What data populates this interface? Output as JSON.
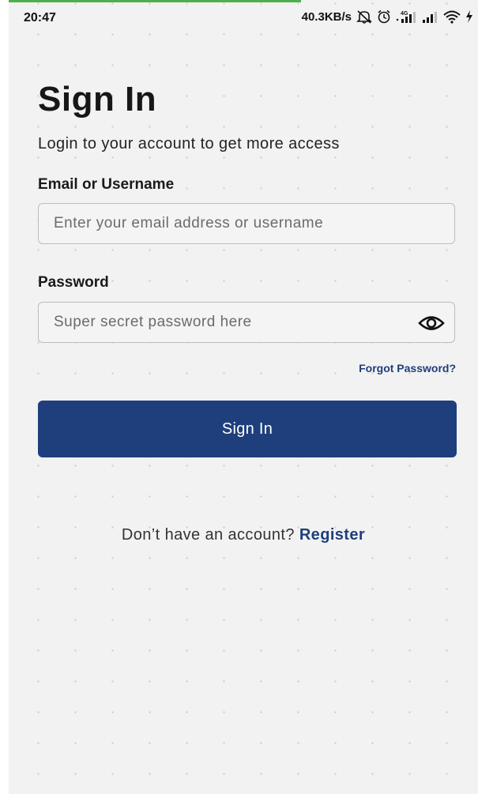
{
  "status_bar": {
    "time": "20:47",
    "net_speed": "40.3KB/s",
    "net_type": "4G"
  },
  "header": {
    "title": "Sign In",
    "subtitle": "Login to your account to get more access"
  },
  "form": {
    "email": {
      "label": "Email or Username",
      "placeholder": "Enter your email address or username",
      "value": ""
    },
    "password": {
      "label": "Password",
      "placeholder": "Super secret password here",
      "value": "",
      "toggle_icon": "eye-icon"
    },
    "forgot_password": "Forgot Password?",
    "submit_label": "Sign In"
  },
  "footer": {
    "prompt": "Don’t have an account?",
    "register_label": "Register"
  },
  "colors": {
    "primary": "#1e3f7c",
    "background": "#f2f2f2",
    "load_bar": "#4cb04c"
  }
}
